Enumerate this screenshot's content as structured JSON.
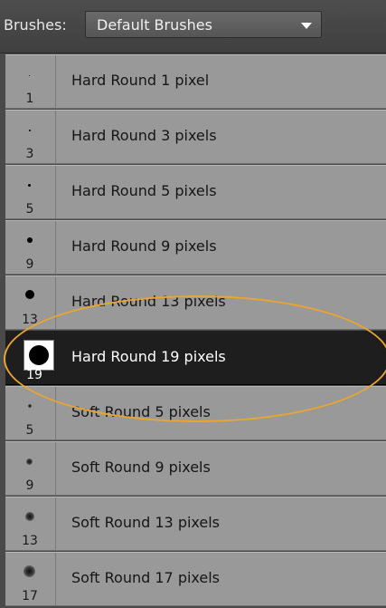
{
  "header": {
    "label": "Brushes:",
    "preset_value": "Default Brushes"
  },
  "brushes": [
    {
      "name": "Hard Round 1 pixel",
      "size": "1"
    },
    {
      "name": "Hard Round 3 pixels",
      "size": "3"
    },
    {
      "name": "Hard Round 5 pixels",
      "size": "5"
    },
    {
      "name": "Hard Round 9 pixels",
      "size": "9"
    },
    {
      "name": "Hard Round 13 pixels",
      "size": "13"
    },
    {
      "name": "Hard Round 19 pixels",
      "size": "19",
      "selected": true
    },
    {
      "name": "Soft Round 5 pixels",
      "size": "5"
    },
    {
      "name": "Soft Round 9 pixels",
      "size": "9"
    },
    {
      "name": "Soft Round 13 pixels",
      "size": "13"
    },
    {
      "name": "Soft Round 17 pixels",
      "size": "17"
    }
  ],
  "colors": {
    "selected_row": "#1e1e1e",
    "row": "#999999",
    "highlight_ellipse": "#e8a530"
  },
  "icons": {
    "dropdown": "chevron-down-icon"
  }
}
